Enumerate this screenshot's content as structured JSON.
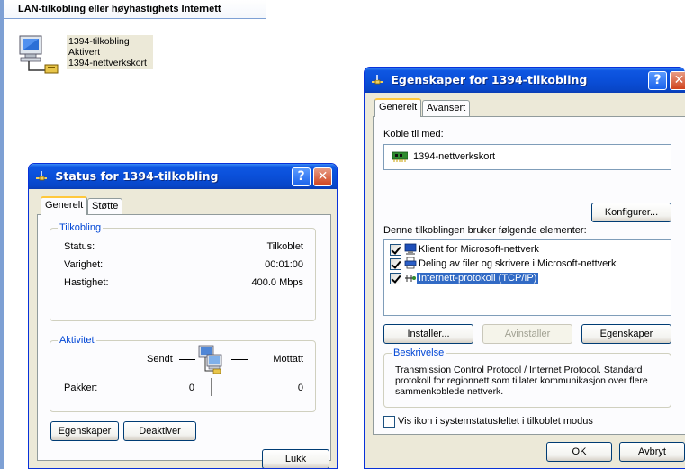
{
  "explorer": {
    "section_header": "LAN-tilkobling eller høyhastighets Internett",
    "connection": {
      "name": "1394-tilkobling",
      "state": "Aktivert",
      "device": "1394-nettverkskort"
    }
  },
  "status_dialog": {
    "title": "Status for 1394-tilkobling",
    "help_glyph": "?",
    "close_glyph": "✕",
    "tabs": [
      "Generelt",
      "Støtte"
    ],
    "connection_group": {
      "legend": "Tilkobling",
      "status_label": "Status:",
      "status_value": "Tilkoblet",
      "duration_label": "Varighet:",
      "duration_value": "00:01:00",
      "speed_label": "Hastighet:",
      "speed_value": "400.0 Mbps"
    },
    "activity_group": {
      "legend": "Aktivitet",
      "sent_label": "Sendt",
      "received_label": "Mottatt",
      "packets_label": "Pakker:",
      "packets_sent": "0",
      "packets_received": "0"
    },
    "buttons": {
      "properties": "Egenskaper",
      "disable": "Deaktiver",
      "close": "Lukk"
    }
  },
  "properties_dialog": {
    "title": "Egenskaper for 1394-tilkobling",
    "help_glyph": "?",
    "close_glyph": "✕",
    "tabs": [
      "Generelt",
      "Avansert"
    ],
    "connect_using_label": "Koble til med:",
    "adapter_name": "1394-nettverkskort",
    "configure_button": "Konfigurer...",
    "items_label": "Denne tilkoblingen bruker følgende elementer:",
    "items": [
      {
        "label": "Klient for Microsoft-nettverk",
        "checked": true,
        "icon": "network-client-icon"
      },
      {
        "label": "Deling av filer og skrivere i Microsoft-nettverk",
        "checked": true,
        "icon": "printer-share-icon"
      },
      {
        "label": "Internett-protokoll (TCP/IP)",
        "checked": true,
        "icon": "protocol-icon",
        "selected": true
      }
    ],
    "install_button": "Installer...",
    "uninstall_button": "Avinstaller",
    "properties_button": "Egenskaper",
    "description_legend": "Beskrivelse",
    "description_text": "Transmission Control Protocol / Internet Protocol. Standard protokoll for regionnett som tillater kommunikasjon over flere sammenkoblede nettverk.",
    "show_icon_label": "Vis ikon i systemstatusfeltet i tilkoblet modus",
    "show_icon_checked": false,
    "ok_button": "OK",
    "cancel_button": "Avbryt"
  }
}
